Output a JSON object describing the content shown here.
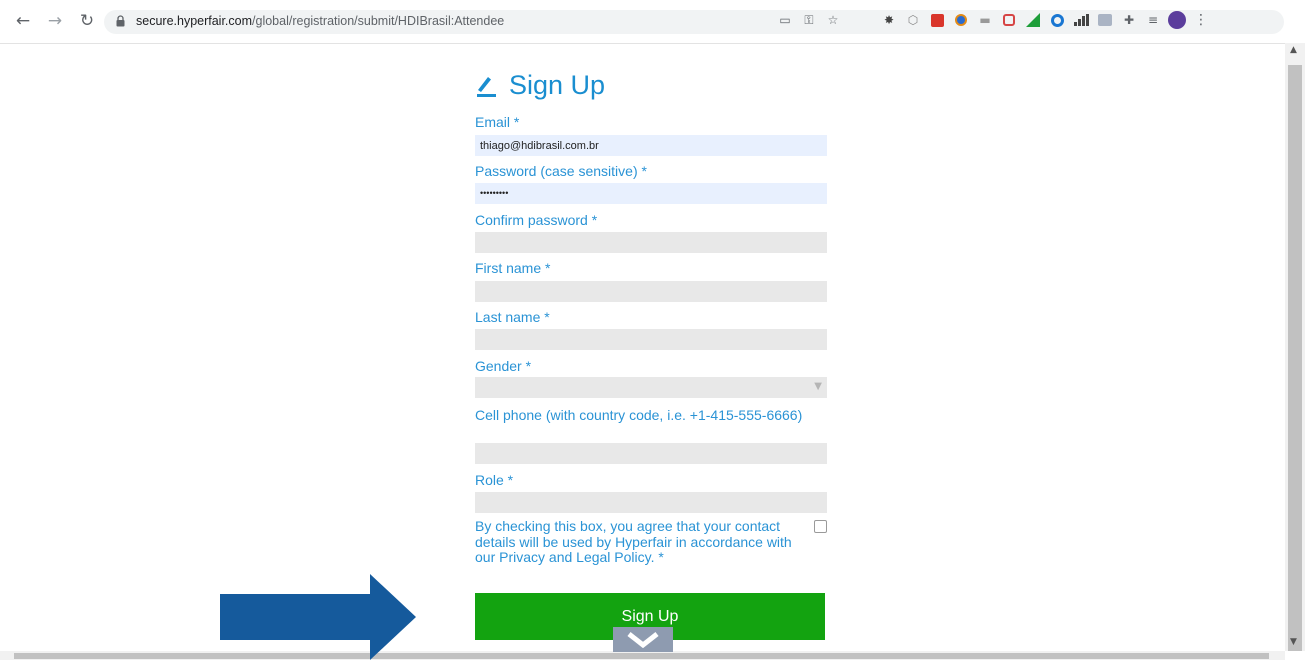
{
  "browser": {
    "url_host": "secure.hyperfair.com",
    "url_path": "/global/registration/submit/HDIBrasil:Attendee"
  },
  "form": {
    "title": "Sign Up",
    "fields": [
      {
        "label": "Email *",
        "value": "thiago@hdibrasil.com.br"
      },
      {
        "label": "Password (case sensitive) *",
        "value": "•••••••••"
      },
      {
        "label": "Confirm password *",
        "value": ""
      },
      {
        "label": "First name *",
        "value": ""
      },
      {
        "label": "Last name *",
        "value": ""
      },
      {
        "label": "Gender *",
        "value": ""
      },
      {
        "label": "Cell phone (with country code, i.e. +1-415-555-6666)",
        "value": ""
      },
      {
        "label": "Role *",
        "value": ""
      }
    ],
    "consent_text": "By checking this box, you agree that your contact details will be used by Hyperfair in accordance with our Privacy and Legal Policy. *",
    "consent_checked": false,
    "submit_label": "Sign Up"
  },
  "icons": {
    "title_icon": "pencil-edit-icon",
    "annotation": "right-arrow-icon",
    "scroll_hint": "chevron-down-icon"
  },
  "colors": {
    "label": "#2a93d5",
    "title": "#1a8ed0",
    "submit_bg": "#13a310",
    "annotation_arrow": "#155a9c",
    "filled_field": "#e8f0fe",
    "empty_field": "#e8e8e8"
  }
}
